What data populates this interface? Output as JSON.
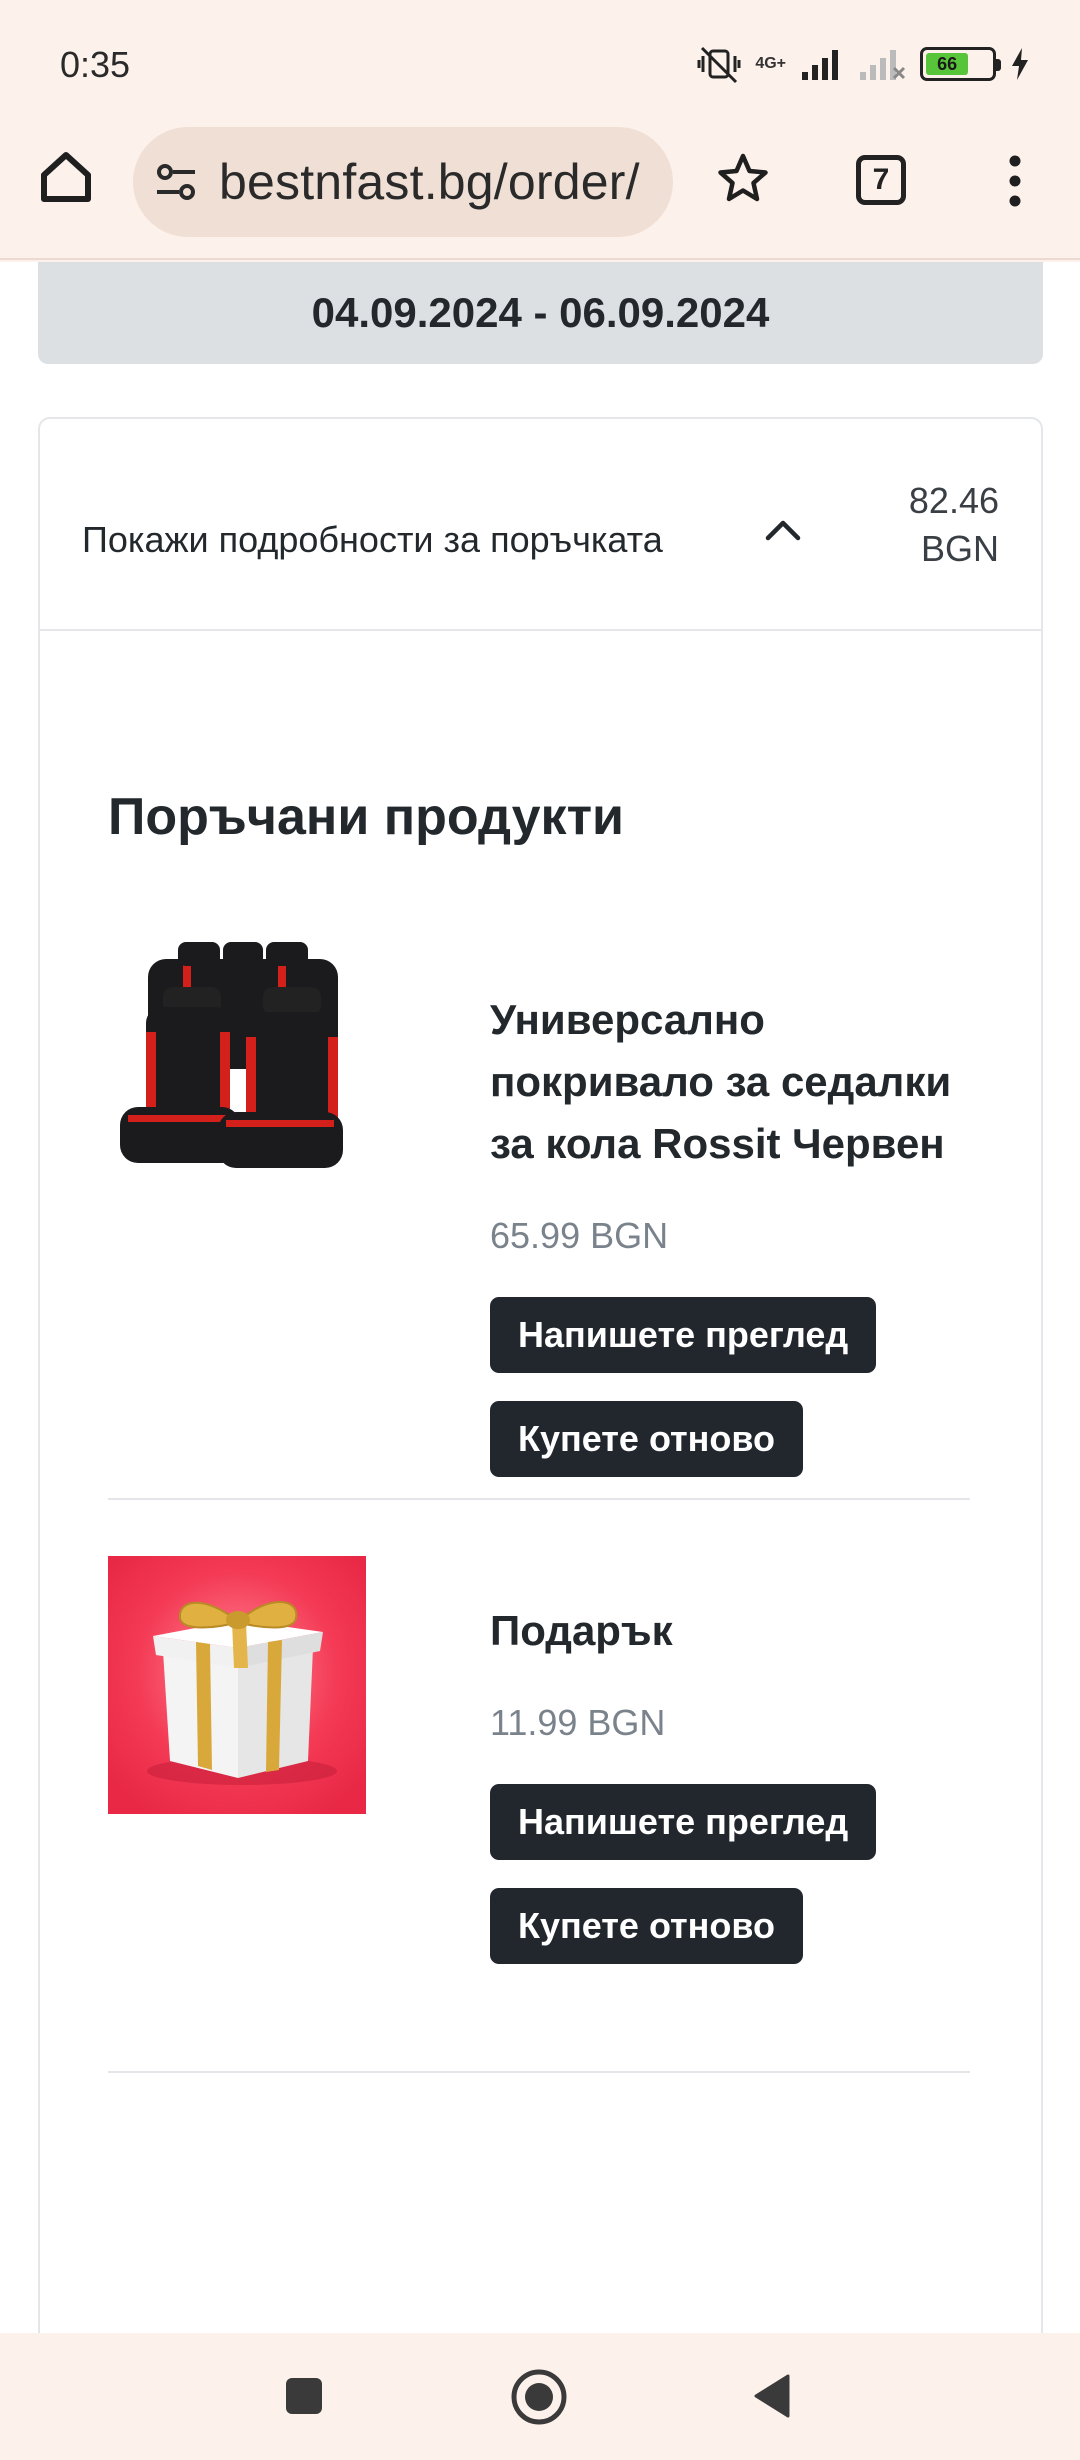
{
  "status_bar": {
    "time": "0:35",
    "network": "4G+",
    "battery": "66"
  },
  "browser": {
    "url": "bestnfast.bg/order/",
    "tab_count": "7"
  },
  "order": {
    "delivery_range": "04.09.2024 - 06.09.2024",
    "toggle_label": "Покажи подробности за поръчката",
    "total_amount": "82.46",
    "total_currency": "BGN"
  },
  "section_title": "Поръчани продукти",
  "products": [
    {
      "name": "Универсално покривало за седалки за кола Rossit Червен",
      "price": "65.99 BGN",
      "review_label": "Напишете преглед",
      "buy_again_label": "Купете отново",
      "image": "car-seat-covers-black-red"
    },
    {
      "name": "Подарък",
      "price": "11.99 BGN",
      "review_label": "Напишете преглед",
      "buy_again_label": "Купете отново",
      "image": "gift-box-gold-ribbon"
    }
  ],
  "colors": {
    "browser_chrome": "#fdf1ec",
    "url_pill": "#f0dfd5",
    "date_banner": "#dde0e3",
    "button": "#22272e",
    "price_text": "#7a838c",
    "gift_background": "#f43a55",
    "seat_accent": "#d4201a"
  }
}
